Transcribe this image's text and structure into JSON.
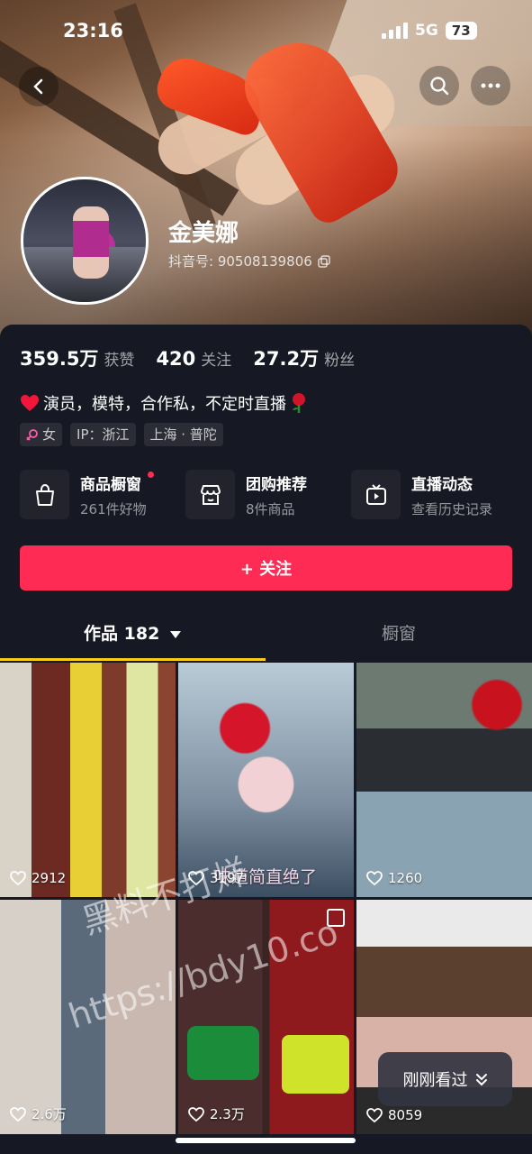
{
  "status_bar": {
    "time": "23:16",
    "network": "5G",
    "battery": "73"
  },
  "profile": {
    "name": "金美娜",
    "douyin_id_label": "抖音号: 90508139806",
    "stats": [
      {
        "value": "359.5万",
        "label": "获赞"
      },
      {
        "value": "420",
        "label": "关注"
      },
      {
        "value": "27.2万",
        "label": "粉丝"
      }
    ],
    "bio": "演员，模特，合作私，不定时直播",
    "tags": {
      "gender": "女",
      "ip": "IP：浙江",
      "location": "上海 · 普陀"
    }
  },
  "features": [
    {
      "title": "商品橱窗",
      "sub": "261件好物",
      "icon": "bag-icon"
    },
    {
      "title": "团购推荐",
      "sub": "8件商品",
      "icon": "store-icon"
    },
    {
      "title": "直播动态",
      "sub": "查看历史记录",
      "icon": "tv-icon"
    }
  ],
  "follow_button": "+ 关注",
  "tabs": {
    "works": "作品 182",
    "shop": "橱窗"
  },
  "videos": [
    {
      "likes": "2912",
      "caption": ""
    },
    {
      "likes": "3197",
      "caption": "味道简直绝了"
    },
    {
      "likes": "1260",
      "caption": ""
    },
    {
      "likes": "2.6万",
      "caption": ""
    },
    {
      "likes": "2.3万",
      "caption": ""
    },
    {
      "likes": "8059",
      "caption": ""
    }
  ],
  "watermark": {
    "line1": "黑料不打烊",
    "line2": "https://bdy10.co"
  },
  "recent_button": "刚刚看过",
  "colors": {
    "accent": "#fe2c55",
    "tab_underline": "#face15",
    "background": "#161823"
  }
}
